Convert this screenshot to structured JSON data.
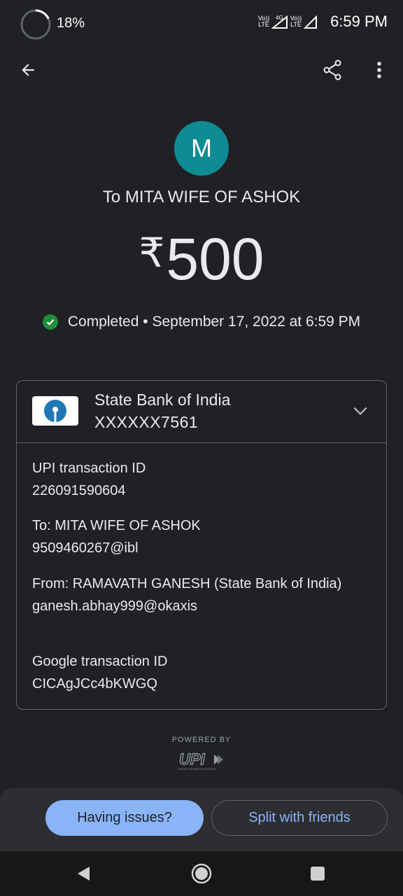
{
  "status_bar": {
    "battery": "18%",
    "time": "6:59 PM",
    "sim1_label": "Vo)) LTE",
    "net_label": "4G",
    "sim2_label": "Vo)) LTE"
  },
  "app_bar": {
    "back_icon": "arrow-back-icon",
    "share_icon": "share-icon",
    "more_icon": "more-vert-icon"
  },
  "payee": {
    "avatar_letter": "M",
    "avatar_color": "#0f8b94",
    "to_label": "To MITA WIFE OF ASHOK"
  },
  "amount": {
    "currency": "₹",
    "value": "500"
  },
  "status": {
    "text": "Completed",
    "separator": "•",
    "datetime": "September 17, 2022 at 6:59 PM",
    "color": "#1e8e3e"
  },
  "bank": {
    "name": "State Bank of India",
    "account": "XXXXXX7561",
    "brand_color": "#1f78b4"
  },
  "details": {
    "upi_label": "UPI transaction ID",
    "upi_value": "226091590604",
    "to_label": "To: MITA WIFE OF ASHOK",
    "to_value": "9509460267@ibl",
    "from_label": "From: RAMAVATH  GANESH (State Bank of India)",
    "from_value": "ganesh.abhay999@okaxis",
    "google_label": "Google transaction ID",
    "google_value": "CICAgJCc4bKWGQ"
  },
  "footer": {
    "powered_by": "POWERED BY",
    "upi_logo_text": "UPI",
    "upi_tagline": "UNIFIED PAYMENTS INTERFACE"
  },
  "actions": {
    "issues_label": "Having issues?",
    "split_label": "Split with friends",
    "accent": "#8ab4f8"
  },
  "nav": {
    "back": "nav-back-icon",
    "home": "nav-home-icon",
    "recents": "nav-recents-icon"
  }
}
